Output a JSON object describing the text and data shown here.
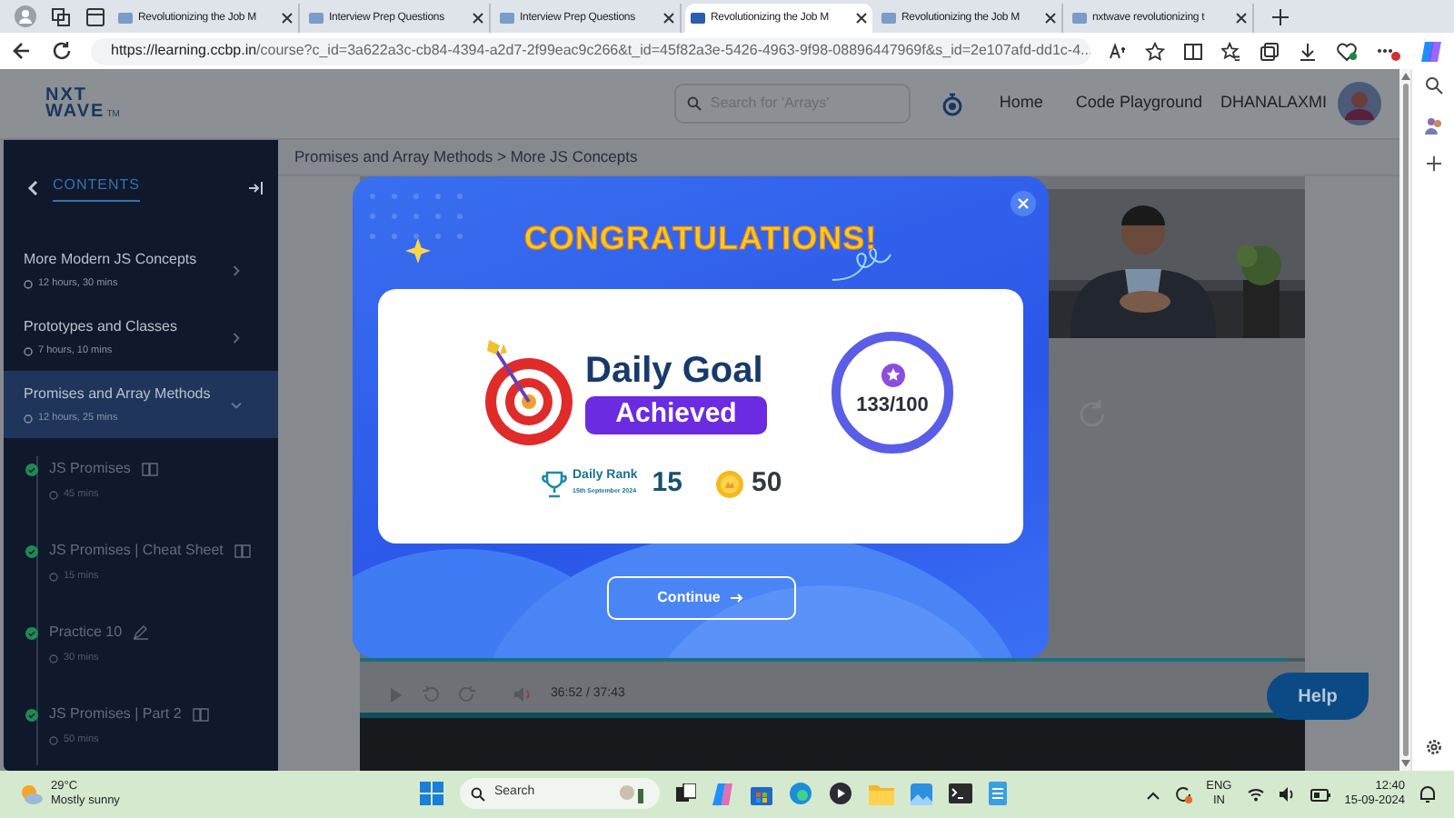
{
  "browser": {
    "tabs": [
      {
        "title": "Revolutionizing the Job M",
        "selected": false
      },
      {
        "title": "Interview Prep Questions",
        "selected": false
      },
      {
        "title": "Interview Prep Questions",
        "selected": false
      },
      {
        "title": "Revolutionizing the Job M",
        "selected": true
      },
      {
        "title": "Revolutionizing the Job M",
        "selected": false
      },
      {
        "title": "nxtwave revolutionizing t",
        "selected": false
      }
    ],
    "url_host": "https://learning.ccbp.in",
    "url_path": "/course?c_id=3a622a3c-cb84-4394-a2d7-2f99eac9c266&t_id=45f82a3e-5426-4963-9f98-08896447969f&s_id=2e107afd-dd1c-4..."
  },
  "header": {
    "logo_top": "NXT",
    "logo_bottom": "WAVE",
    "logo_mark": "TM",
    "search": {
      "placeholder": "Search for 'Arrays'"
    },
    "nav": [
      "Home",
      "Code Playground"
    ],
    "user": "DHANALAXMI"
  },
  "sidebar": {
    "title": "CONTENTS",
    "sections": [
      {
        "title": "More Modern JS Concepts",
        "duration": "12 hours, 30 mins",
        "selected": false,
        "expanded": false
      },
      {
        "title": "Prototypes and Classes",
        "duration": "7 hours, 10 mins",
        "selected": false,
        "expanded": false
      },
      {
        "title": "Promises and Array Methods",
        "duration": "12 hours, 25 mins",
        "selected": true,
        "expanded": true
      }
    ],
    "lessons": [
      {
        "title": "JS Promises",
        "duration": "45 mins",
        "kind": "reading",
        "done": true
      },
      {
        "title": "JS Promises | Cheat Sheet",
        "duration": "15 mins",
        "kind": "reading",
        "done": true
      },
      {
        "title": "Practice 10",
        "duration": "30 mins",
        "kind": "practice",
        "done": true
      },
      {
        "title": "JS Promises | Part 2",
        "duration": "50 mins",
        "kind": "reading",
        "done": true
      }
    ]
  },
  "breadcrumb": "Promises and Array Methods > More JS Concepts",
  "video": {
    "time": "36:52 / 37:43",
    "level": 0.98
  },
  "modal": {
    "heading": "CONGRATULATIONS!",
    "goal_title": "Daily Goal",
    "goal_badge": "Achieved",
    "score": "133/100",
    "level": 1,
    "rank_label": "Daily Rank",
    "rank_date": "15th September 2024",
    "rank": "15",
    "coins": "50",
    "button": "Continue"
  },
  "help": "Help",
  "taskbar": {
    "temperature": "29°C",
    "weather": "Mostly sunny",
    "search": "Search",
    "language": "ENG",
    "region": "IN",
    "time": "12:40",
    "date": "15-09-2024"
  }
}
